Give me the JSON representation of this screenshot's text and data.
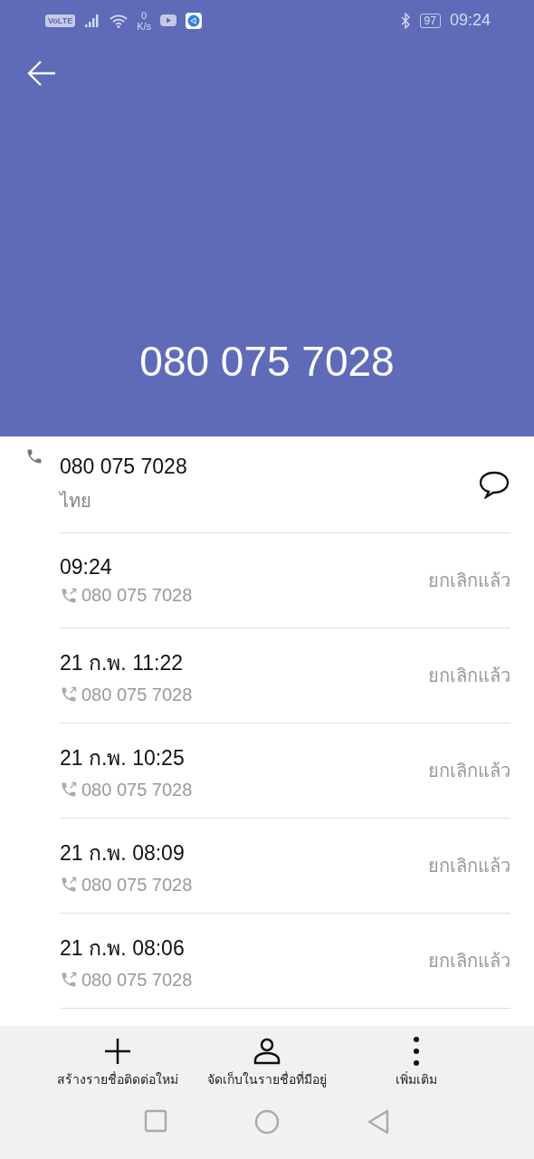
{
  "status_bar": {
    "volte": "VoLTE",
    "speed_value": "0",
    "speed_unit": "K/s",
    "battery": "97",
    "time": "09:24"
  },
  "header": {
    "title": "080 075 7028"
  },
  "number_row": {
    "number": "080 075 7028",
    "location": "ไทย"
  },
  "calls": [
    {
      "time": "09:24",
      "number": "080 075 7028",
      "status": "ยกเลิกแล้ว"
    },
    {
      "time": "21 ก.พ. 11:22",
      "number": "080 075 7028",
      "status": "ยกเลิกแล้ว"
    },
    {
      "time": "21 ก.พ. 10:25",
      "number": "080 075 7028",
      "status": "ยกเลิกแล้ว"
    },
    {
      "time": "21 ก.พ. 08:09",
      "number": "080 075 7028",
      "status": "ยกเลิกแล้ว"
    },
    {
      "time": "21 ก.พ. 08:06",
      "number": "080 075 7028",
      "status": "ยกเลิกแล้ว"
    }
  ],
  "actions": [
    {
      "kind": "add",
      "label": "สร้างรายชื่อติดต่อใหม่"
    },
    {
      "kind": "person",
      "label": "จัดเก็บในรายชื่อที่มีอยู่"
    },
    {
      "kind": "more",
      "label": "เพิ่มเติม"
    }
  ]
}
